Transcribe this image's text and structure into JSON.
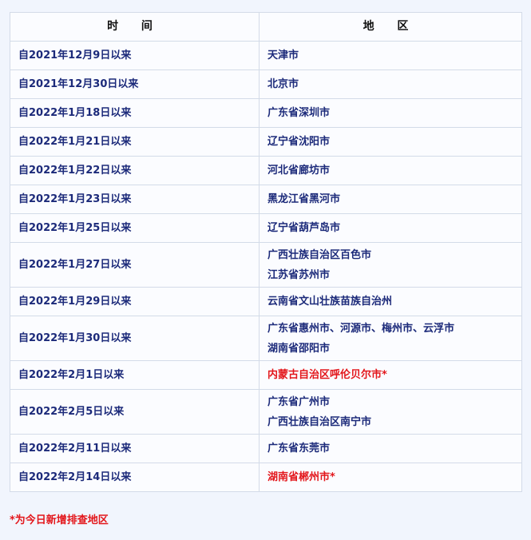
{
  "table": {
    "headers": [
      "时 间",
      "地 区"
    ],
    "rows": [
      {
        "time": "自2021年12月9日以来",
        "areas": [
          "天津市"
        ],
        "highlight": false
      },
      {
        "time": "自2021年12月30日以来",
        "areas": [
          "北京市"
        ],
        "highlight": false
      },
      {
        "time": "自2022年1月18日以来",
        "areas": [
          "广东省深圳市"
        ],
        "highlight": false
      },
      {
        "time": "自2022年1月21日以来",
        "areas": [
          "辽宁省沈阳市"
        ],
        "highlight": false
      },
      {
        "time": "自2022年1月22日以来",
        "areas": [
          "河北省廊坊市"
        ],
        "highlight": false
      },
      {
        "time": "自2022年1月23日以来",
        "areas": [
          "黑龙江省黑河市"
        ],
        "highlight": false
      },
      {
        "time": "自2022年1月25日以来",
        "areas": [
          "辽宁省葫芦岛市"
        ],
        "highlight": false
      },
      {
        "time": "自2022年1月27日以来",
        "areas": [
          "广西壮族自治区百色市",
          "江苏省苏州市"
        ],
        "highlight": false
      },
      {
        "time": "自2022年1月29日以来",
        "areas": [
          "云南省文山壮族苗族自治州"
        ],
        "highlight": false
      },
      {
        "time": "自2022年1月30日以来",
        "areas": [
          "广东省惠州市、河源市、梅州市、云浮市",
          "湖南省邵阳市"
        ],
        "highlight": false
      },
      {
        "time": "自2022年2月1日以来",
        "areas": [
          "内蒙古自治区呼伦贝尔市*"
        ],
        "highlight": true
      },
      {
        "time": "自2022年2月5日以来",
        "areas": [
          "广东省广州市",
          "广西壮族自治区南宁市"
        ],
        "highlight": false
      },
      {
        "time": "自2022年2月11日以来",
        "areas": [
          "广东省东莞市"
        ],
        "highlight": false
      },
      {
        "time": "自2022年2月14日以来",
        "areas": [
          "湖南省郴州市*"
        ],
        "highlight": true
      }
    ]
  },
  "note": "*为今日新增排查地区",
  "colors": {
    "text": "#1c2a7a",
    "highlight": "#e3161b",
    "background": "#f1f5fd",
    "border": "#d3dbe8"
  }
}
